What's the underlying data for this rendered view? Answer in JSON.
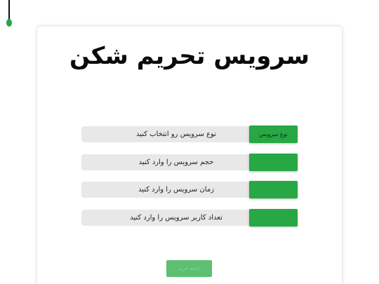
{
  "page": {
    "title": "سرویس تحریم شکن",
    "accent_color": "#28a745"
  },
  "rows": [
    {
      "placeholder": "نوع سرویس رو انتخاب کنید",
      "button_label": "نوع سرویس"
    },
    {
      "placeholder": "حجم سرویس را وارد کنید",
      "button_label": ""
    },
    {
      "placeholder": "زمان سرویس را وارد کنید",
      "button_label": ""
    },
    {
      "placeholder": "تعداد کاربر سرویس را وارد کنید",
      "button_label": ""
    }
  ],
  "submit": {
    "label": "ادامه خرید"
  }
}
